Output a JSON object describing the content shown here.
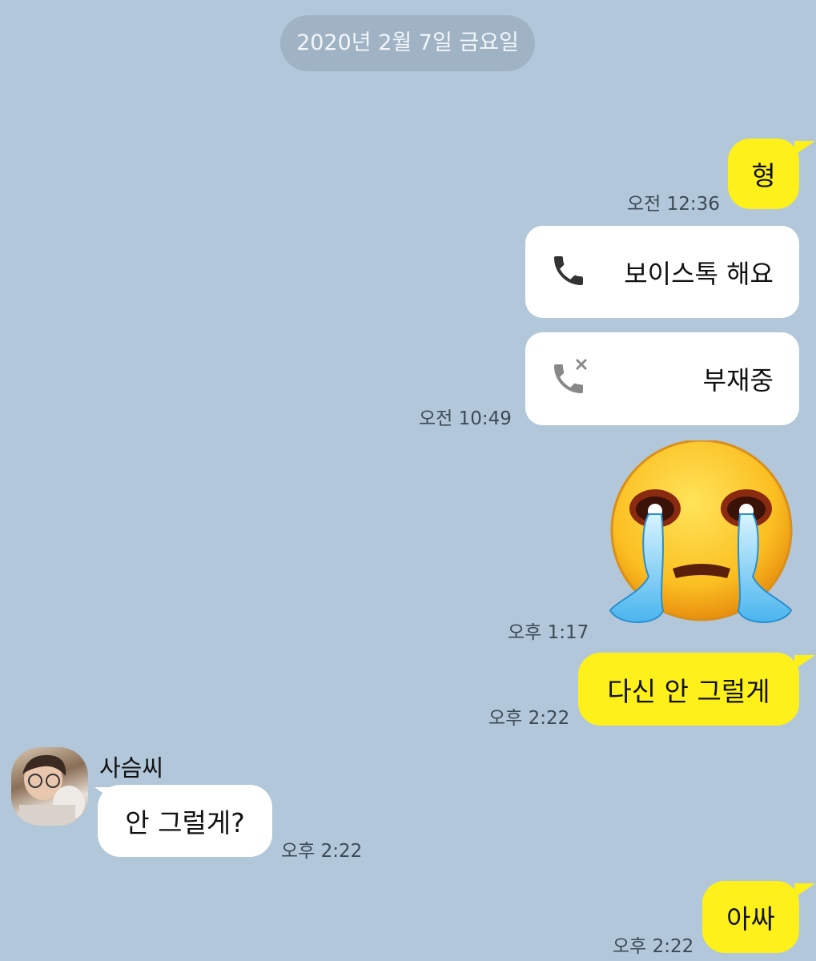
{
  "date_divider": "2020년 2월 7일 금요일",
  "messages": {
    "m1": {
      "text": "형",
      "time": "오전 12:36"
    },
    "call1": {
      "label": "보이스톡 해요",
      "icon": "phone-icon"
    },
    "call2": {
      "label": "부재중",
      "icon": "missed-call-icon",
      "time": "오전 10:49"
    },
    "emoticon": {
      "name": "crying-face-emoticon",
      "time": "오후 1:17"
    },
    "m2": {
      "text": "다신 안 그럴게",
      "time": "오후 2:22"
    },
    "m3": {
      "sender": "사슴씨",
      "text": "안 그럴게?",
      "time": "오후 2:22"
    },
    "m4": {
      "text": "아싸",
      "time": "오후 2:22"
    }
  },
  "colors": {
    "background": "#b2c7d9",
    "my_bubble": "#fef01b",
    "other_bubble": "#ffffff"
  }
}
